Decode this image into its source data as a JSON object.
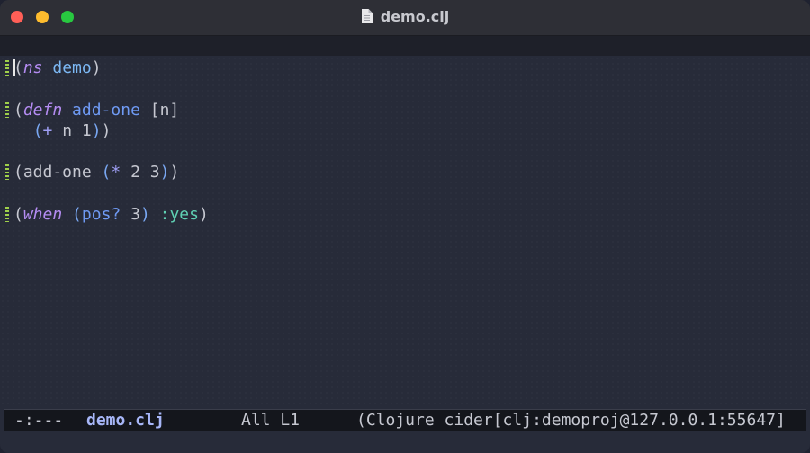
{
  "window": {
    "title": "demo.clj",
    "file_icon": "document-icon"
  },
  "editor": {
    "lines": [
      {
        "tokens": [
          {
            "t": "(",
            "c": "plain"
          },
          {
            "t": "ns",
            "c": "kw"
          },
          {
            "t": " ",
            "c": "plain"
          },
          {
            "t": "demo",
            "c": "ns"
          },
          {
            "t": ")",
            "c": "plain"
          }
        ]
      },
      {
        "tokens": [
          {
            "t": "(",
            "c": "plain"
          },
          {
            "t": "defn",
            "c": "kw"
          },
          {
            "t": " ",
            "c": "plain"
          },
          {
            "t": "add-one",
            "c": "fn"
          },
          {
            "t": " [n]",
            "c": "plain"
          }
        ]
      },
      {
        "tokens": [
          {
            "t": "  ",
            "c": "plain"
          },
          {
            "t": "(",
            "c": "paren2"
          },
          {
            "t": "+",
            "c": "op"
          },
          {
            "t": " n 1",
            "c": "plain"
          },
          {
            "t": ")",
            "c": "paren2"
          },
          {
            "t": ")",
            "c": "plain"
          }
        ]
      },
      {
        "tokens": [
          {
            "t": "(add-one ",
            "c": "plain"
          },
          {
            "t": "(",
            "c": "paren2"
          },
          {
            "t": "*",
            "c": "op"
          },
          {
            "t": " 2 3",
            "c": "plain"
          },
          {
            "t": ")",
            "c": "paren2"
          },
          {
            "t": ")",
            "c": "plain"
          }
        ]
      },
      {
        "tokens": [
          {
            "t": "(",
            "c": "plain"
          },
          {
            "t": "when",
            "c": "kw"
          },
          {
            "t": " ",
            "c": "plain"
          },
          {
            "t": "(",
            "c": "paren2"
          },
          {
            "t": "pos?",
            "c": "fn"
          },
          {
            "t": " 3",
            "c": "plain"
          },
          {
            "t": ")",
            "c": "paren2"
          },
          {
            "t": " ",
            "c": "plain"
          },
          {
            "t": ":yes",
            "c": "kwd"
          },
          {
            "t": ")",
            "c": "plain"
          }
        ]
      }
    ]
  },
  "modeline": {
    "status": "-:---",
    "buffer": "demo.clj",
    "position": "All L1",
    "modes": "(Clojure cider[clj:demoproj@127.0.0.1:55647]"
  },
  "colors": {
    "background": "#272b39",
    "keyword": "#b48cf2",
    "namespace": "#7cb8f4",
    "function": "#6f9af4",
    "clj_keyword": "#5fd0b3",
    "fringe": "#9fd04a"
  }
}
